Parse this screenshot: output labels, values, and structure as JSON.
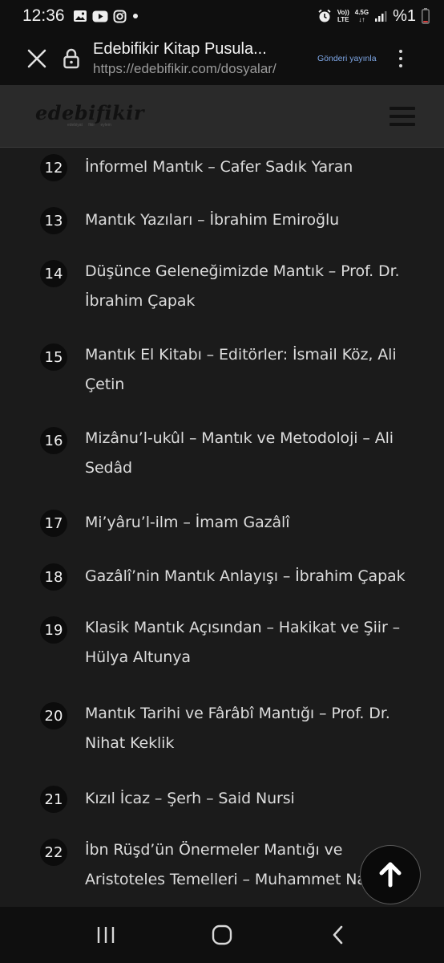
{
  "status_bar": {
    "time": "12:36",
    "left_icons": [
      "image-icon",
      "youtube-icon",
      "instagram-icon",
      "dot-icon"
    ],
    "network_top": "Vo))",
    "network_bottom": "LTE",
    "network_speed": "4.5G",
    "battery": "%1"
  },
  "browser": {
    "page_title": "Edebifikir Kitap Pusula...",
    "url": "https://edebifikir.com/dosyalar/",
    "publish_label": "Gönderi yayınla"
  },
  "site": {
    "logo": "edebifikir",
    "tagline": "edebiyat fikir eylem"
  },
  "books": [
    {
      "num": "12",
      "title": "İnformel Mantık – Cafer Sadık Yaran"
    },
    {
      "num": "13",
      "title": "Mantık Yazıları – İbrahim Emiroğlu"
    },
    {
      "num": "14",
      "title": "Düşünce Geleneğimizde Mantık – Prof. Dr. İbrahim Çapak"
    },
    {
      "num": "15",
      "title": "Mantık El Kitabı – Editörler: İsmail Köz, Ali Çetin"
    },
    {
      "num": "16",
      "title": "Mizânu’l-ukûl – Mantık ve Metodoloji – Ali Sedâd"
    },
    {
      "num": "17",
      "title": "Mi’yâru’l-ilm – İmam Gazâlî"
    },
    {
      "num": "18",
      "title": "Gazâlî’nin Mantık Anlayışı – İbrahim Çapak"
    },
    {
      "num": "19",
      "title": "Klasik Mantık Açısından – Hakikat ve Şiir – Hülya Altunya"
    },
    {
      "num": "20",
      "title": "Mantık Tarihi ve Fârâbî Mantığı – Prof. Dr. Nihat Keklik"
    },
    {
      "num": "21",
      "title": "Kızıl İcaz – Şerh – Said Nursi"
    },
    {
      "num": "22",
      "title": "İbn Rüşd’ün Önermeler Mantığı ve Aristoteles Temelleri – Muhammet Nasrullah"
    }
  ],
  "nav": {
    "recent_icon": "recent-apps-icon",
    "home_icon": "home-icon",
    "back_icon": "back-icon"
  }
}
